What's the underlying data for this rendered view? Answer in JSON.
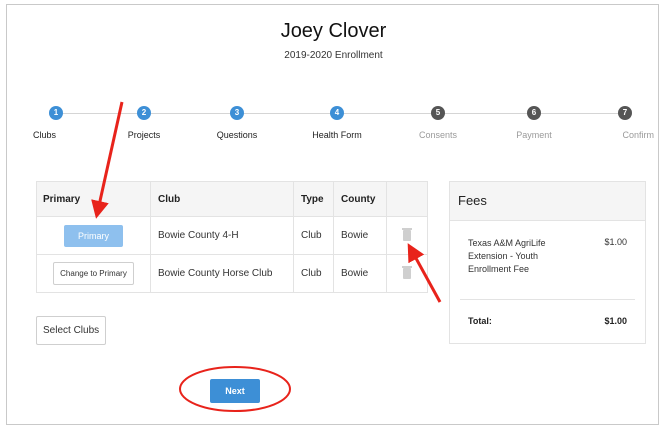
{
  "header": {
    "name": "Joey Clover",
    "subtitle": "2019-2020 Enrollment"
  },
  "steps": [
    {
      "num": "1",
      "label": "Clubs",
      "state": "active"
    },
    {
      "num": "2",
      "label": "Projects",
      "state": "active"
    },
    {
      "num": "3",
      "label": "Questions",
      "state": "active"
    },
    {
      "num": "4",
      "label": "Health Form",
      "state": "active"
    },
    {
      "num": "5",
      "label": "Consents",
      "state": "inactive"
    },
    {
      "num": "6",
      "label": "Payment",
      "state": "inactive"
    },
    {
      "num": "7",
      "label": "Confirm",
      "state": "inactive"
    }
  ],
  "clubs_table": {
    "headers": [
      "Primary",
      "Club",
      "Type",
      "County"
    ],
    "rows": [
      {
        "action": "Primary",
        "club": "Bowie County 4-H",
        "type": "Club",
        "county": "Bowie"
      },
      {
        "action": "Change to Primary",
        "club": "Bowie County Horse Club",
        "type": "Club",
        "county": "Bowie"
      }
    ]
  },
  "select_clubs_label": "Select Clubs",
  "fees": {
    "title": "Fees",
    "items": [
      {
        "desc": "Texas A&M AgriLife Extension - Youth Enrollment Fee",
        "amount": "$1.00"
      }
    ],
    "total_label": "Total:",
    "total_amount": "$1.00"
  },
  "next_label": "Next",
  "colors": {
    "accent": "#3d8fd6",
    "primary_btn": "#8ec0ee",
    "annotation": "#e8231b"
  }
}
